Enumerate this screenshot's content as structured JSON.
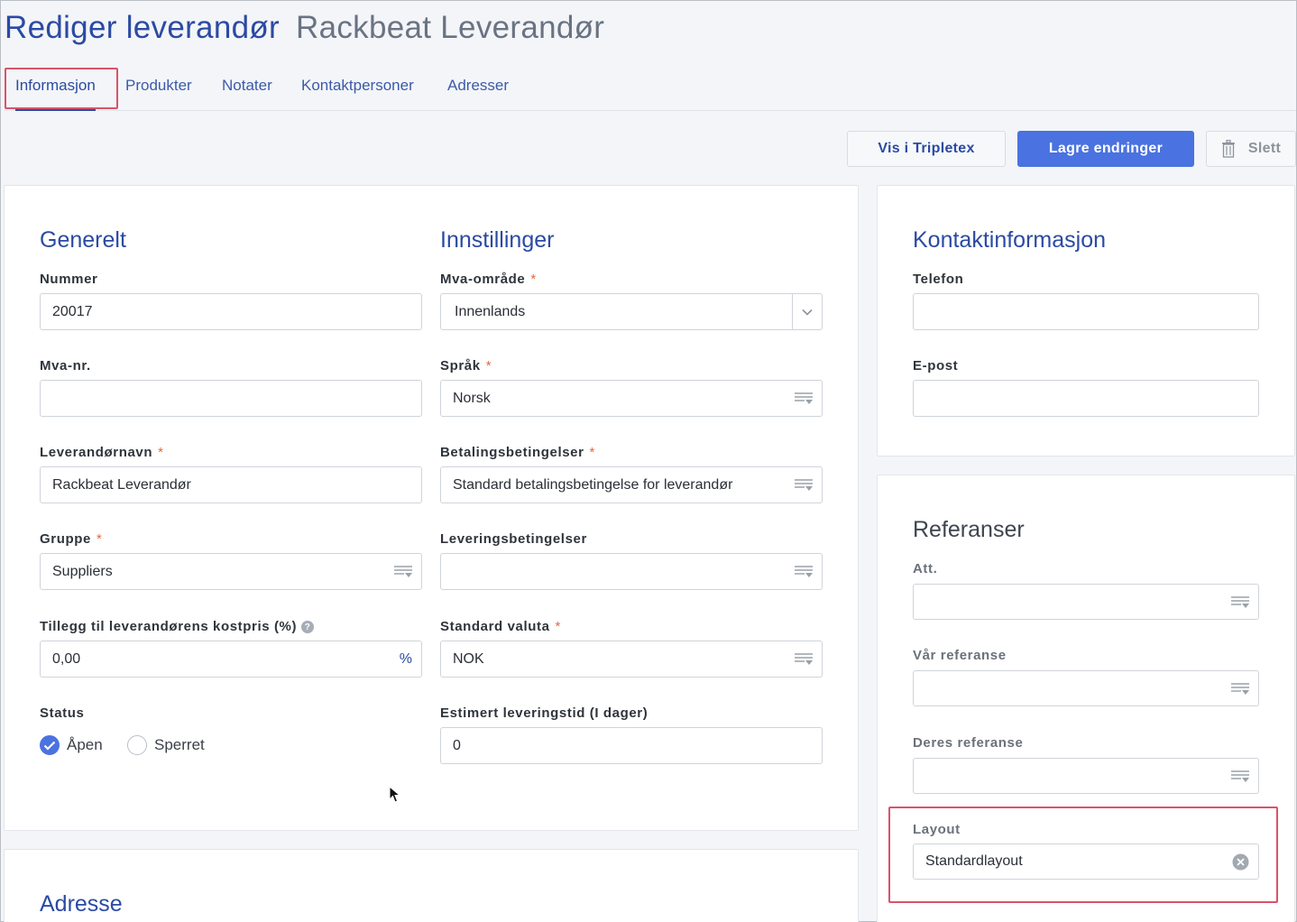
{
  "header": {
    "title": "Rediger leverandør",
    "subtitle": "Rackbeat Leverandør"
  },
  "tabs": [
    {
      "label": "Informasjon",
      "active": true
    },
    {
      "label": "Produkter"
    },
    {
      "label": "Notater"
    },
    {
      "label": "Kontaktpersoner"
    },
    {
      "label": "Adresser"
    }
  ],
  "toolbar": {
    "view_label": "Vis i Tripletex",
    "save_label": "Lagre endringer",
    "delete_label": "Slett"
  },
  "general": {
    "title": "Generelt",
    "number": {
      "label": "Nummer",
      "value": "20017"
    },
    "vat_no": {
      "label": "Mva-nr.",
      "value": ""
    },
    "supplier_name": {
      "label": "Leverandørnavn",
      "value": "Rackbeat Leverandør"
    },
    "group": {
      "label": "Gruppe",
      "value": "Suppliers"
    },
    "markup": {
      "label": "Tillegg til leverandørens kostpris (%)",
      "value": "0,00",
      "unit": "%"
    },
    "status": {
      "label": "Status",
      "options": [
        "Åpen",
        "Sperret"
      ],
      "selected": "Åpen"
    }
  },
  "settings": {
    "title": "Innstillinger",
    "vat_area": {
      "label": "Mva-område",
      "value": "Innenlands"
    },
    "language": {
      "label": "Språk",
      "value": "Norsk"
    },
    "payment_terms": {
      "label": "Betalingsbetingelser",
      "value": "Standard betalingsbetingelse for leverandør"
    },
    "delivery_terms": {
      "label": "Leveringsbetingelser",
      "value": ""
    },
    "currency": {
      "label": "Standard valuta",
      "value": "NOK"
    },
    "lead_time": {
      "label": "Estimert leveringstid (I dager)",
      "value": "0"
    }
  },
  "contact": {
    "title": "Kontaktinformasjon",
    "phone": {
      "label": "Telefon",
      "value": ""
    },
    "email": {
      "label": "E-post",
      "value": ""
    }
  },
  "references": {
    "title": "Referanser",
    "att": {
      "label": "Att.",
      "value": ""
    },
    "our_ref": {
      "label": "Vår referanse",
      "value": ""
    },
    "their_ref": {
      "label": "Deres referanse",
      "value": ""
    },
    "layout": {
      "label": "Layout",
      "value": "Standardlayout"
    }
  },
  "address": {
    "title": "Adresse"
  },
  "colors": {
    "primary": "#4a72e0",
    "heading": "#2b4aa3",
    "highlight": "#d9536a",
    "required": "#e06a3d"
  },
  "icons": {
    "list": "list-filter-icon",
    "chevron": "chevron-down-icon",
    "clear": "clear-icon",
    "trash": "trash-icon",
    "help": "help-icon"
  }
}
